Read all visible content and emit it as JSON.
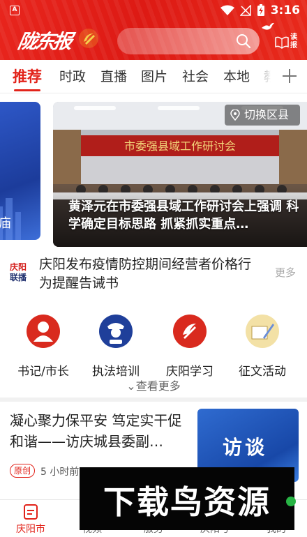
{
  "status_bar": {
    "app_badge": "A",
    "time": "3:16"
  },
  "header": {
    "logo_text": "陇东报",
    "search_placeholder": "",
    "read_news_label": "读报"
  },
  "tabs": [
    {
      "label": "推荐",
      "active": true
    },
    {
      "label": "时政"
    },
    {
      "label": "直播"
    },
    {
      "label": "图片"
    },
    {
      "label": "社会"
    },
    {
      "label": "本地"
    },
    {
      "label": "教"
    }
  ],
  "carousel": {
    "prev_slide_fragment": "庙",
    "banner_text": "市委强县域工作研讨会",
    "caption": "黄泽元在市委强县域工作研讨会上强调 科学确定目标思路 抓紧抓实重点…",
    "switch_county_label": "切换区县"
  },
  "ticker": {
    "logo_top": "庆阳",
    "logo_bottom": "联播",
    "text": "庆阳发布疫情防控期间经营者价格行为提醒告诫书",
    "more_label": "更多"
  },
  "quick_links": [
    {
      "label": "书记/市长",
      "icon": "official-portrait-icon",
      "color": "#d92a1e"
    },
    {
      "label": "执法培训",
      "icon": "police-officer-icon",
      "color": "#1f3f9a"
    },
    {
      "label": "庆阳学习",
      "icon": "study-emblem-icon",
      "color": "#d92a1e"
    },
    {
      "label": "征文活动",
      "icon": "essay-pen-icon",
      "color": "#f3e1a6"
    }
  ],
  "see_more_label": "查看更多",
  "article": {
    "title": "凝心聚力保平安 笃定实干促和谐——访庆城县委副…",
    "thumb_text": "访谈",
    "tag": "原创",
    "time": "5 小时前"
  },
  "bottom_nav": [
    {
      "label": "庆阳市",
      "icon": "news-doc-icon",
      "active": true
    },
    {
      "label": "视频",
      "icon": "video-icon"
    },
    {
      "label": "服务",
      "icon": "service-icon"
    },
    {
      "label": "庆阳号",
      "icon": "account-icon"
    },
    {
      "label": "我的",
      "icon": "profile-icon"
    }
  ],
  "watermark_text": "下载鸟资源"
}
